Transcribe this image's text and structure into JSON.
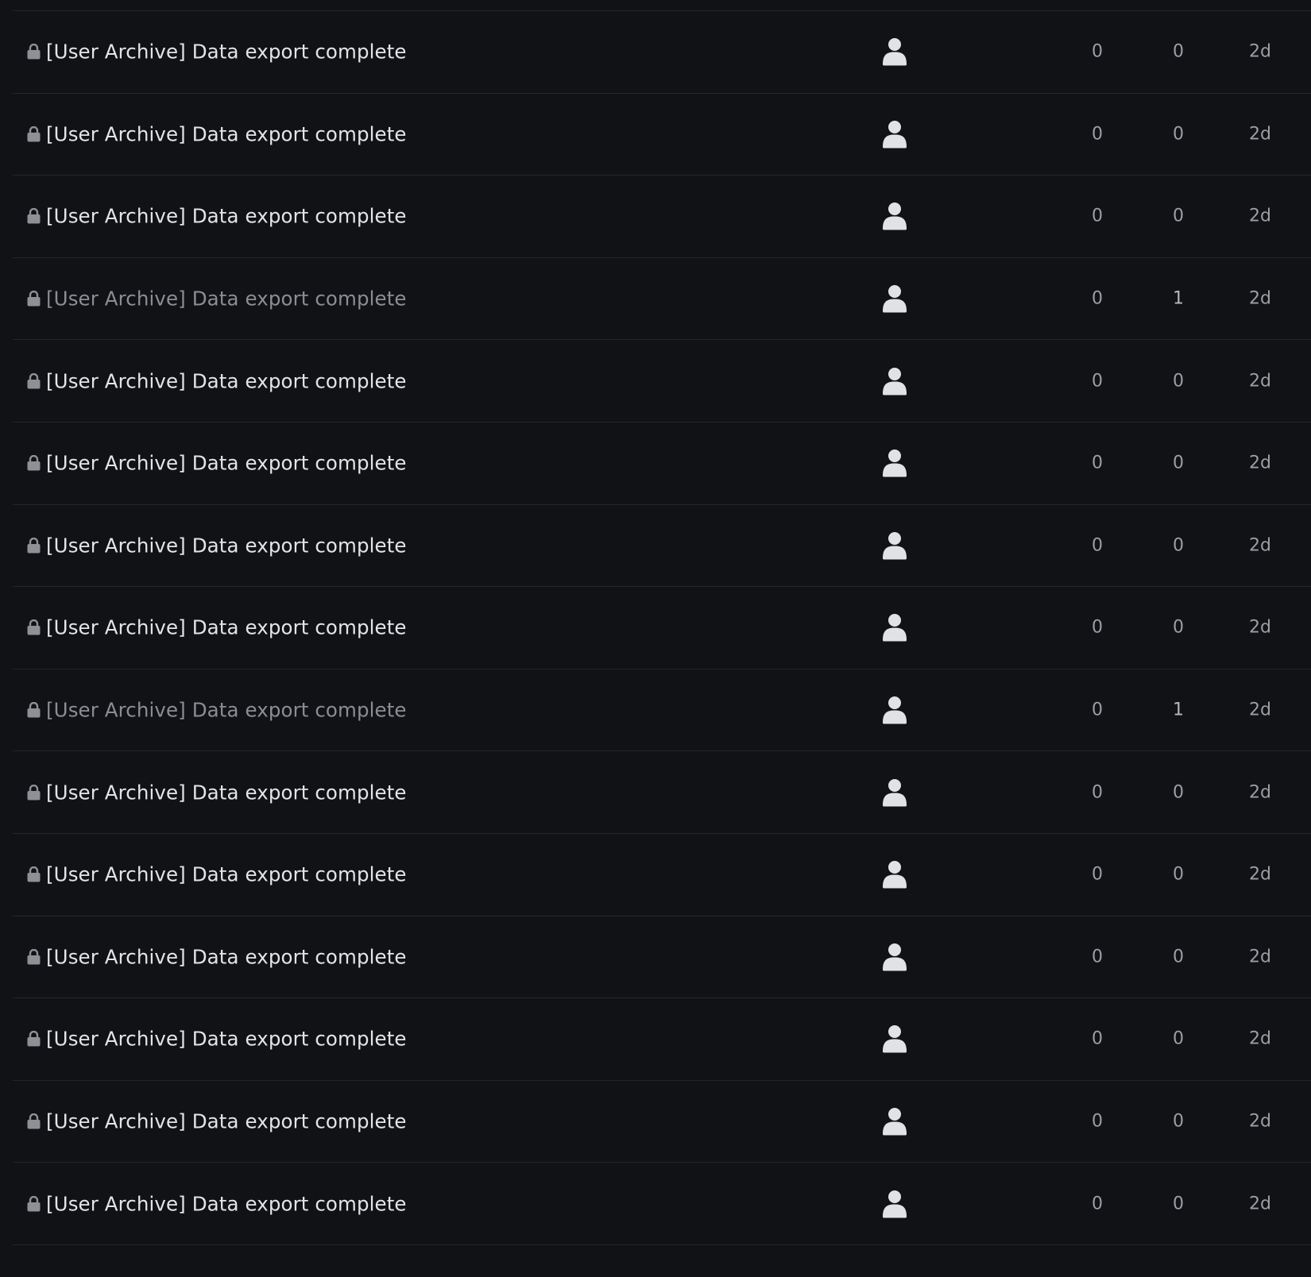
{
  "topics": [
    {
      "title": "[User Archive] Data export complete",
      "replies": "0",
      "views": "0",
      "activity": "2d",
      "read": false
    },
    {
      "title": "[User Archive] Data export complete",
      "replies": "0",
      "views": "0",
      "activity": "2d",
      "read": false
    },
    {
      "title": "[User Archive] Data export complete",
      "replies": "0",
      "views": "0",
      "activity": "2d",
      "read": false
    },
    {
      "title": "[User Archive] Data export complete",
      "replies": "0",
      "views": "1",
      "activity": "2d",
      "read": true
    },
    {
      "title": "[User Archive] Data export complete",
      "replies": "0",
      "views": "0",
      "activity": "2d",
      "read": false
    },
    {
      "title": "[User Archive] Data export complete",
      "replies": "0",
      "views": "0",
      "activity": "2d",
      "read": false
    },
    {
      "title": "[User Archive] Data export complete",
      "replies": "0",
      "views": "0",
      "activity": "2d",
      "read": false
    },
    {
      "title": "[User Archive] Data export complete",
      "replies": "0",
      "views": "0",
      "activity": "2d",
      "read": false
    },
    {
      "title": "[User Archive] Data export complete",
      "replies": "0",
      "views": "1",
      "activity": "2d",
      "read": true
    },
    {
      "title": "[User Archive] Data export complete",
      "replies": "0",
      "views": "0",
      "activity": "2d",
      "read": false
    },
    {
      "title": "[User Archive] Data export complete",
      "replies": "0",
      "views": "0",
      "activity": "2d",
      "read": false
    },
    {
      "title": "[User Archive] Data export complete",
      "replies": "0",
      "views": "0",
      "activity": "2d",
      "read": false
    },
    {
      "title": "[User Archive] Data export complete",
      "replies": "0",
      "views": "0",
      "activity": "2d",
      "read": false
    },
    {
      "title": "[User Archive] Data export complete",
      "replies": "0",
      "views": "0",
      "activity": "2d",
      "read": false
    },
    {
      "title": "[User Archive] Data export complete",
      "replies": "0",
      "views": "0",
      "activity": "2d",
      "read": false
    }
  ],
  "icons": {
    "lock": "lock-icon",
    "avatar": "user-avatar-icon"
  },
  "colors": {
    "background": "#111216",
    "divider": "#24262c",
    "title_unread": "#e3e4e8",
    "title_read": "#8b8d93",
    "lock": "#8e9096",
    "avatar": "#e1e2e6",
    "meta_text": "#9c9ea4"
  }
}
